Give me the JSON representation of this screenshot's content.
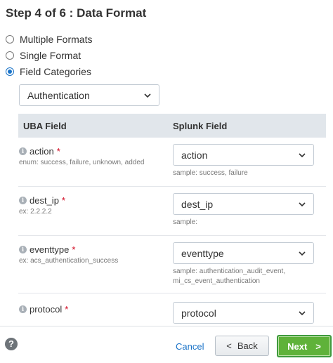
{
  "header": {
    "title": "Step 4 of 6 : Data Format"
  },
  "format_options": [
    {
      "label": "Multiple Formats",
      "checked": false
    },
    {
      "label": "Single Format",
      "checked": false
    },
    {
      "label": "Field Categories",
      "checked": true
    }
  ],
  "category_select": {
    "value": "Authentication"
  },
  "table": {
    "headers": {
      "uba": "UBA Field",
      "splunk": "Splunk Field"
    },
    "rows": [
      {
        "name": "action",
        "required_mark": "*",
        "desc": "enum: success, failure, unknown, added",
        "splunk_value": "action",
        "sample": "sample: success, failure"
      },
      {
        "name": "dest_ip",
        "required_mark": "*",
        "desc": "ex: 2.2.2.2",
        "splunk_value": "dest_ip",
        "sample": "sample:"
      },
      {
        "name": "eventtype",
        "required_mark": "*",
        "desc": "ex: acs_authentication_success",
        "splunk_value": "eventtype",
        "sample": "sample: authentication_audit_event, mi_cs_event_authentication"
      },
      {
        "name": "protocol",
        "required_mark": "*",
        "desc": "",
        "splunk_value": "protocol",
        "sample": ""
      }
    ]
  },
  "footer": {
    "help_glyph": "?",
    "cancel_label": "Cancel",
    "back_label": "Back",
    "back_arrow": "<",
    "next_label": "Next",
    "next_arrow": ">"
  },
  "colors": {
    "accent": "#1a73c8",
    "required": "#d0021b",
    "next_button": "#5fb23a",
    "header_bg": "#e1e6eb"
  },
  "icons": {
    "radio": "radio-icon",
    "select_chevron": "chevron-down-icon",
    "info": "info-icon",
    "help": "question-icon"
  }
}
